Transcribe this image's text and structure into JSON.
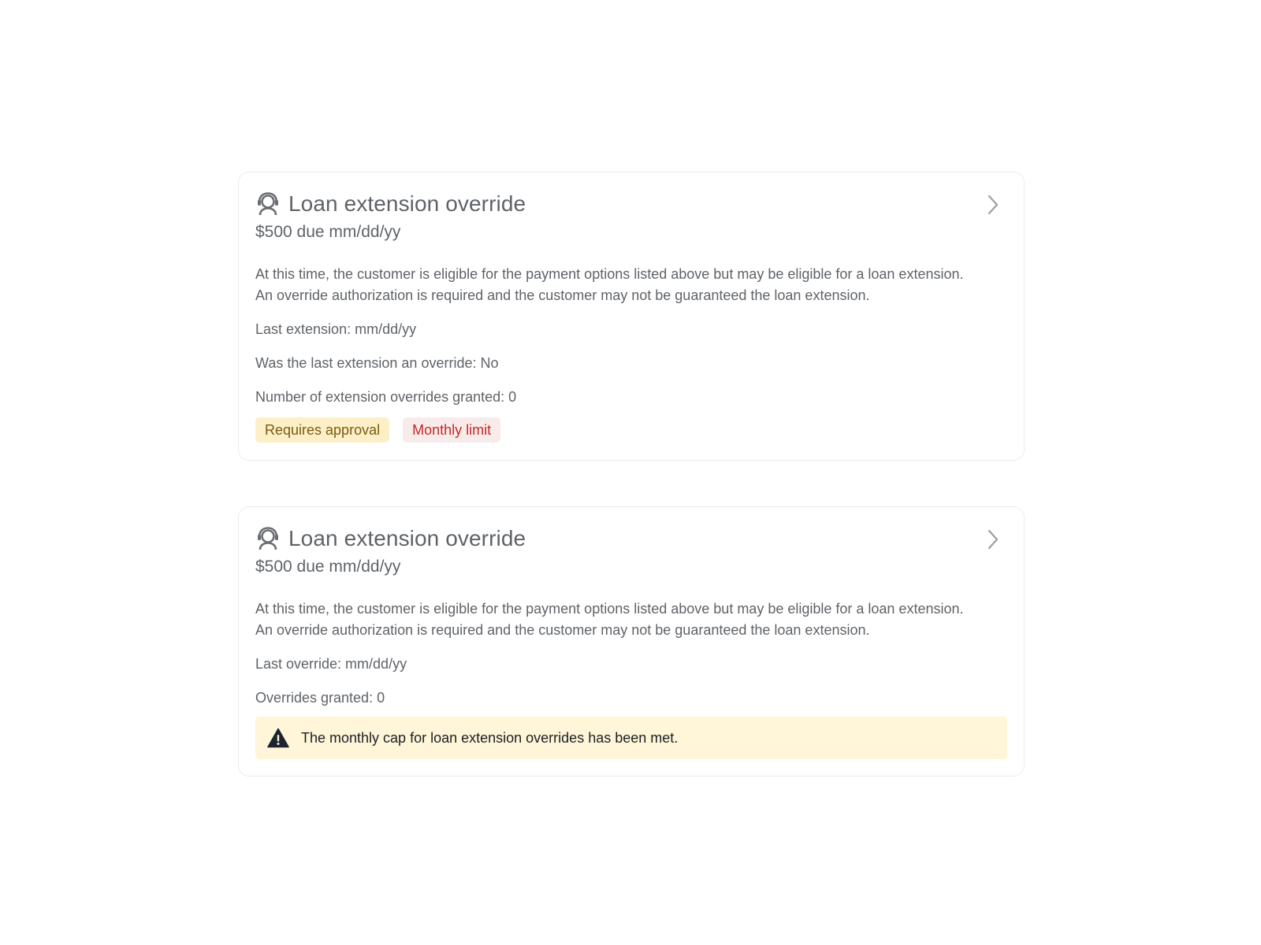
{
  "cards": [
    {
      "icon": "headset-agent-icon",
      "title": "Loan extension override",
      "subtitle": "$500 due mm/dd/yy",
      "description_line1": "At this time, the customer is eligible for the payment options listed above but may be eligible for a loan extension.",
      "description_line2": "An override authorization is required and the customer may not be guaranteed the loan extension.",
      "details": [
        "Last extension: mm/dd/yy",
        "Was the last extension an override: No",
        "Number of extension overrides granted: 0"
      ],
      "badges": [
        {
          "label": "Requires approval",
          "color": "#7a5a10",
          "background": "#fdf0c8"
        },
        {
          "label": "Monthly limit",
          "color": "#c62828",
          "background": "#f8eceb"
        }
      ]
    },
    {
      "icon": "headset-agent-icon",
      "title": "Loan extension override",
      "subtitle": "$500 due mm/dd/yy",
      "description_line1": "At this time, the customer is eligible for the payment options listed above but may be eligible for a loan extension.",
      "description_line2": "An override authorization is required and the customer may not be guaranteed the loan extension.",
      "details": [
        "Last override: mm/dd/yy",
        "Overrides granted: 0"
      ],
      "alert": {
        "icon": "warning-triangle-icon",
        "text": "The monthly cap for loan extension overrides has been met.",
        "background": "#fff5d8"
      }
    }
  ],
  "colors": {
    "text": "#5f6368",
    "border": "#ececec",
    "chevron": "#9e9e9e"
  }
}
